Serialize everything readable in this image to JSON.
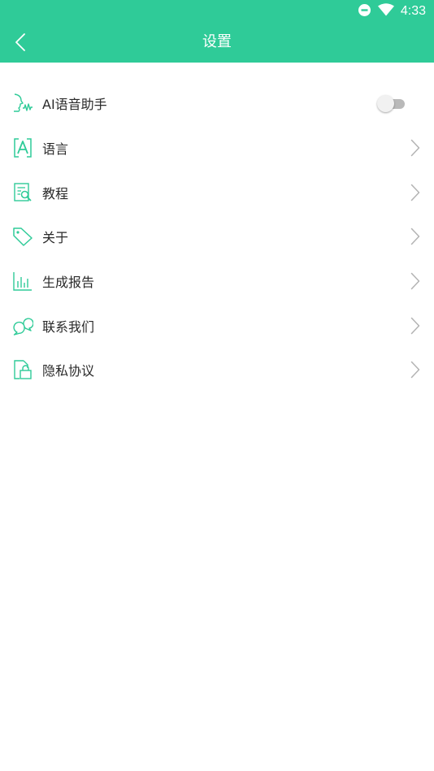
{
  "status_bar": {
    "time": "4:33",
    "icons": [
      "do-not-disturb-icon",
      "wifi-icon"
    ]
  },
  "header": {
    "title": "设置",
    "back_icon": "back-arrow-icon"
  },
  "colors": {
    "primary": "#2fcb98",
    "icon": "#2fcb98",
    "text": "#2a2a2a",
    "chevron": "#b3b3b3"
  },
  "settings": {
    "items": [
      {
        "label": "AI语音助手",
        "icon": "voice-assistant-icon",
        "control": "toggle",
        "enabled": false
      },
      {
        "label": "语言",
        "icon": "language-icon",
        "control": "chevron"
      },
      {
        "label": "教程",
        "icon": "tutorial-icon",
        "control": "chevron"
      },
      {
        "label": "关于",
        "icon": "tag-icon",
        "control": "chevron"
      },
      {
        "label": "生成报告",
        "icon": "bar-chart-icon",
        "control": "chevron"
      },
      {
        "label": "联系我们",
        "icon": "chat-bubbles-icon",
        "control": "chevron"
      },
      {
        "label": "隐私协议",
        "icon": "lock-document-icon",
        "control": "chevron"
      }
    ]
  }
}
